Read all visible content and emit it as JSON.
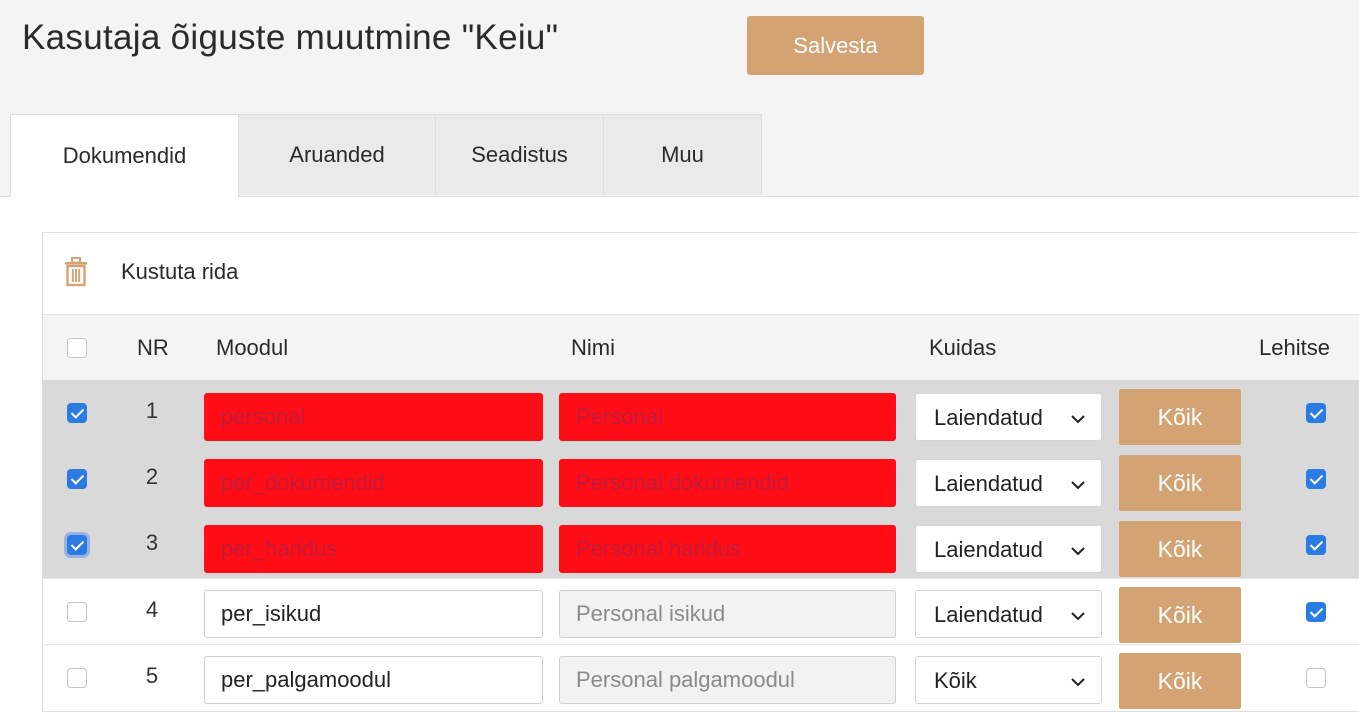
{
  "header": {
    "title": "Kasutaja õiguste muutmine  \"Keiu\"",
    "save_label": "Salvesta"
  },
  "tabs": [
    {
      "label": "Dokumendid",
      "active": true
    },
    {
      "label": "Aruanded",
      "active": false
    },
    {
      "label": "Seadistus",
      "active": false
    },
    {
      "label": "Muu",
      "active": false
    }
  ],
  "toolbar": {
    "delete_label": "Kustuta rida",
    "delete_icon": "trash-icon"
  },
  "table": {
    "columns": {
      "nr": "NR",
      "module": "Moodul",
      "name": "Nimi",
      "how": "Kuidas",
      "browse": "Lehitse"
    },
    "all_button_label": "Kõik",
    "rows": [
      {
        "checked": true,
        "nr": "1",
        "module": "personal",
        "name": "Personal",
        "how": "Laiendatud",
        "browse": true,
        "highlight": true
      },
      {
        "checked": true,
        "nr": "2",
        "module": "per_dokumendid",
        "name": "Personal dokumendid",
        "how": "Laiendatud",
        "browse": true,
        "highlight": true
      },
      {
        "checked": true,
        "nr": "3",
        "module": "per_haridus",
        "name": "Personal haridus",
        "how": "Laiendatud",
        "browse": true,
        "highlight": true
      },
      {
        "checked": false,
        "nr": "4",
        "module": "per_isikud",
        "name": "Personal isikud",
        "how": "Laiendatud",
        "browse": true,
        "highlight": false
      },
      {
        "checked": false,
        "nr": "5",
        "module": "per_palgamoodul",
        "name": "Personal palgamoodul",
        "how": "Kõik",
        "browse": false,
        "highlight": false
      }
    ]
  },
  "colors": {
    "accent_button": "#d4a373",
    "highlight_red": "#ff0d16",
    "checkbox_blue": "#2b7be4",
    "selected_row_bg": "#d9d9d9"
  }
}
